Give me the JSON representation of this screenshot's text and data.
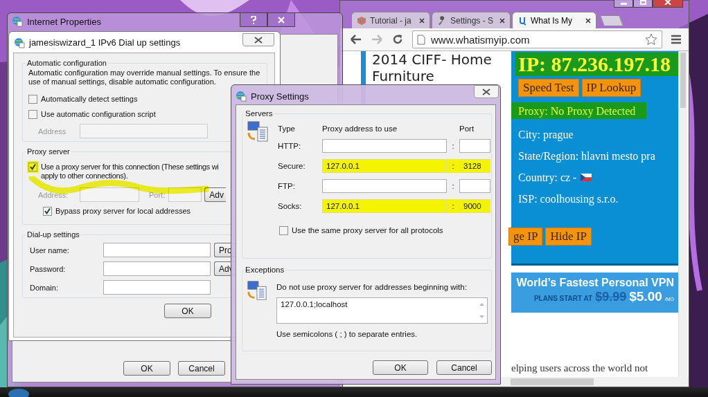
{
  "browser": {
    "tabs": [
      {
        "label": "Tutorial - ja",
        "selected": false
      },
      {
        "label": "Settings - S",
        "selected": false
      },
      {
        "label": "What Is My",
        "selected": true
      }
    ],
    "url": "www.whatismyip.com",
    "article_title": "2014 CIFF- Home Furniture",
    "ip": {
      "text": "IP: 87.236.197.18",
      "highlighted": true
    },
    "top_buttons": [
      "Speed Test",
      "IP Lookup"
    ],
    "details": [
      {
        "label": "Proxy:",
        "value": "No Proxy Detected",
        "highlighted": true,
        "flag": false
      },
      {
        "label": "City:",
        "value": "prague",
        "highlighted": false,
        "flag": false
      },
      {
        "label": "State/Region:",
        "value": "hlavni mesto pra",
        "highlighted": false,
        "flag": false
      },
      {
        "label": "Country:",
        "value": "cz -",
        "highlighted": false,
        "flag": true
      },
      {
        "label": "ISP:",
        "value": "coolhousing s.r.o.",
        "highlighted": false,
        "flag": false
      }
    ],
    "bottom_buttons": [
      "ge IP",
      "Hide IP"
    ],
    "ad": {
      "headline": "World’s Fastest Personal VPN",
      "prefix": "PLANS START AT",
      "old_price": "$9.99",
      "new_price": "$5.00",
      "unit": "/MO"
    },
    "body_text": "elping users across the world not"
  },
  "internet_properties": {
    "title": "Internet Properties",
    "buttons": [
      "OK",
      "Cancel"
    ]
  },
  "dialup": {
    "title": "jamesiswizard_1 IPv6 Dial up settings",
    "auto_config": {
      "heading": "Automatic configuration",
      "description": "Automatic configuration may override manual settings.  To ensure the use of manual settings, disable automatic configuration.",
      "options": [
        {
          "label": "Automatically detect settings",
          "checked": false
        },
        {
          "label": "Use automatic configuration script",
          "checked": false
        }
      ],
      "address_label": "Address",
      "address_disabled": true
    },
    "proxy_server": {
      "heading": "Proxy server",
      "use_proxy_lines": [
        "Use a proxy server for this connection (These settings wi",
        "apply to other connections)."
      ],
      "use_proxy_checked": true,
      "highlighted": true,
      "address_label": "Address:",
      "port_label": "Port:",
      "disabled": true,
      "advanced_button": "Adv",
      "bypass": {
        "label": "Bypass proxy server for local addresses",
        "checked": true
      }
    },
    "dialup_settings": {
      "heading": "Dial-up settings",
      "fields": [
        {
          "label": "User name:"
        },
        {
          "label": "Password:"
        },
        {
          "label": "Domain:"
        }
      ],
      "side_buttons": [
        "Pro",
        "Adv"
      ]
    },
    "ok_button": "OK"
  },
  "proxy": {
    "title": "Proxy Settings",
    "servers_heading": "Servers",
    "columns": [
      "Type",
      "Proxy address to use",
      "Port"
    ],
    "rows": [
      {
        "type": "HTTP:",
        "separator": ":",
        "highlighted": false
      },
      {
        "type": "Secure:",
        "address": "127.0.0.1",
        "separator": ":",
        "port": "3128",
        "highlighted": true
      },
      {
        "type": "FTP:",
        "separator": ":",
        "highlighted": false
      },
      {
        "type": "Socks:",
        "address": "127.0.0.1",
        "separator": ":",
        "port": "9000",
        "highlighted": true
      }
    ],
    "same_proxy": {
      "label": "Use the same proxy server for all protocols",
      "checked": false
    },
    "exceptions_heading": "Exceptions",
    "exceptions_description": "Do not use proxy server for addresses beginning with:",
    "exceptions_value": "127.0.0.1;localhost",
    "exceptions_hint": "Use semicolons ( ; ) to separate entries.",
    "buttons": [
      "OK",
      "Cancel"
    ]
  }
}
